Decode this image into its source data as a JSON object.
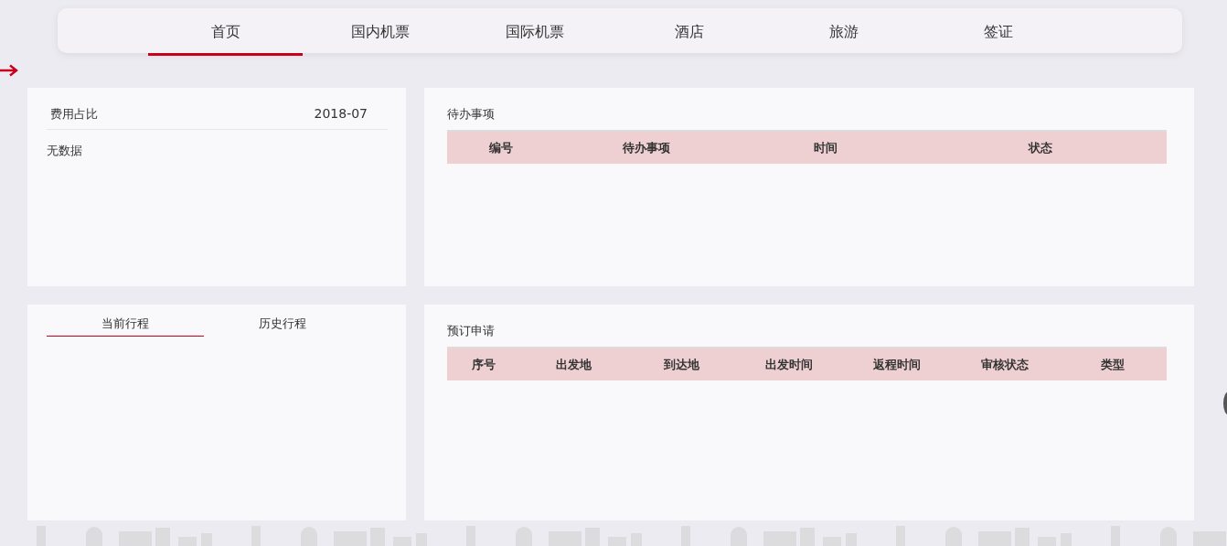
{
  "nav": {
    "tabs": [
      {
        "label": "首页",
        "selected": true
      },
      {
        "label": "国内机票",
        "selected": false
      },
      {
        "label": "国际机票",
        "selected": false
      },
      {
        "label": "酒店",
        "selected": false
      },
      {
        "label": "旅游",
        "selected": false
      },
      {
        "label": "签证",
        "selected": false
      }
    ]
  },
  "expense": {
    "title": "费用占比",
    "period": "2018-07",
    "empty": "无数据"
  },
  "todo": {
    "title": "待办事项",
    "columns": [
      "编号",
      "待办事项",
      "时间",
      "状态"
    ]
  },
  "trips": {
    "tabs": [
      {
        "label": "当前行程",
        "selected": true
      },
      {
        "label": "历史行程",
        "selected": false
      }
    ]
  },
  "bookings": {
    "title": "预订申请",
    "columns": [
      "序号",
      "出发地",
      "到达地",
      "出发时间",
      "返程时间",
      "审核状态",
      "类型"
    ]
  }
}
